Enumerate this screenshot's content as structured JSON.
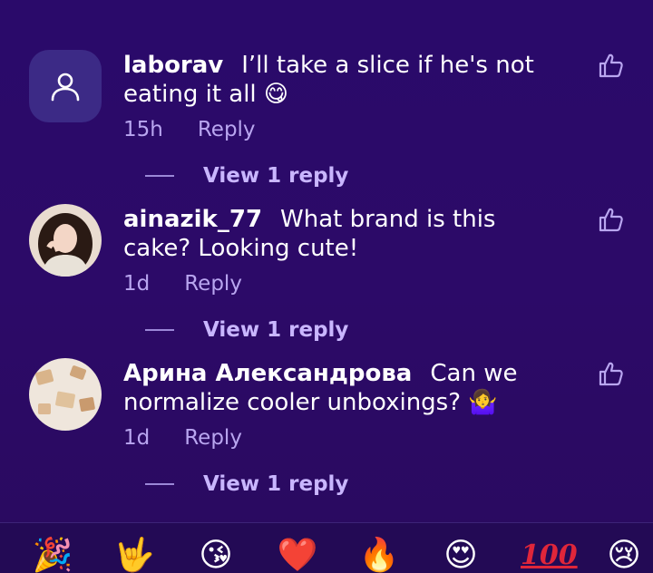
{
  "comments": [
    {
      "username": "laborav",
      "text": "I’ll take a slice if he's not eating it all 😋",
      "time": "15h",
      "reply_label": "Reply",
      "view_replies": "View 1 reply",
      "avatar": "default-user-icon"
    },
    {
      "username": "ainazik_77",
      "text": "What brand is this cake? Looking cute!",
      "time": "1d",
      "reply_label": "Reply",
      "view_replies": "View 1 reply",
      "avatar": "profile-photo"
    },
    {
      "username": "Арина Александрова",
      "text": "Can we normalize cooler unboxings? 🤷‍♀️",
      "time": "1d",
      "reply_label": "Reply",
      "view_replies": "View 1 reply",
      "avatar": "profile-photo"
    }
  ],
  "emoji_bar": [
    "🎉",
    "🤟",
    "😘",
    "❤️",
    "🔥",
    "😍",
    "100",
    "😢"
  ],
  "colors": {
    "background": "#2a0a6a",
    "meta_text": "#b9a6f0",
    "view_replies": "#c9b6ff",
    "hundred_red": "#e0263a"
  }
}
